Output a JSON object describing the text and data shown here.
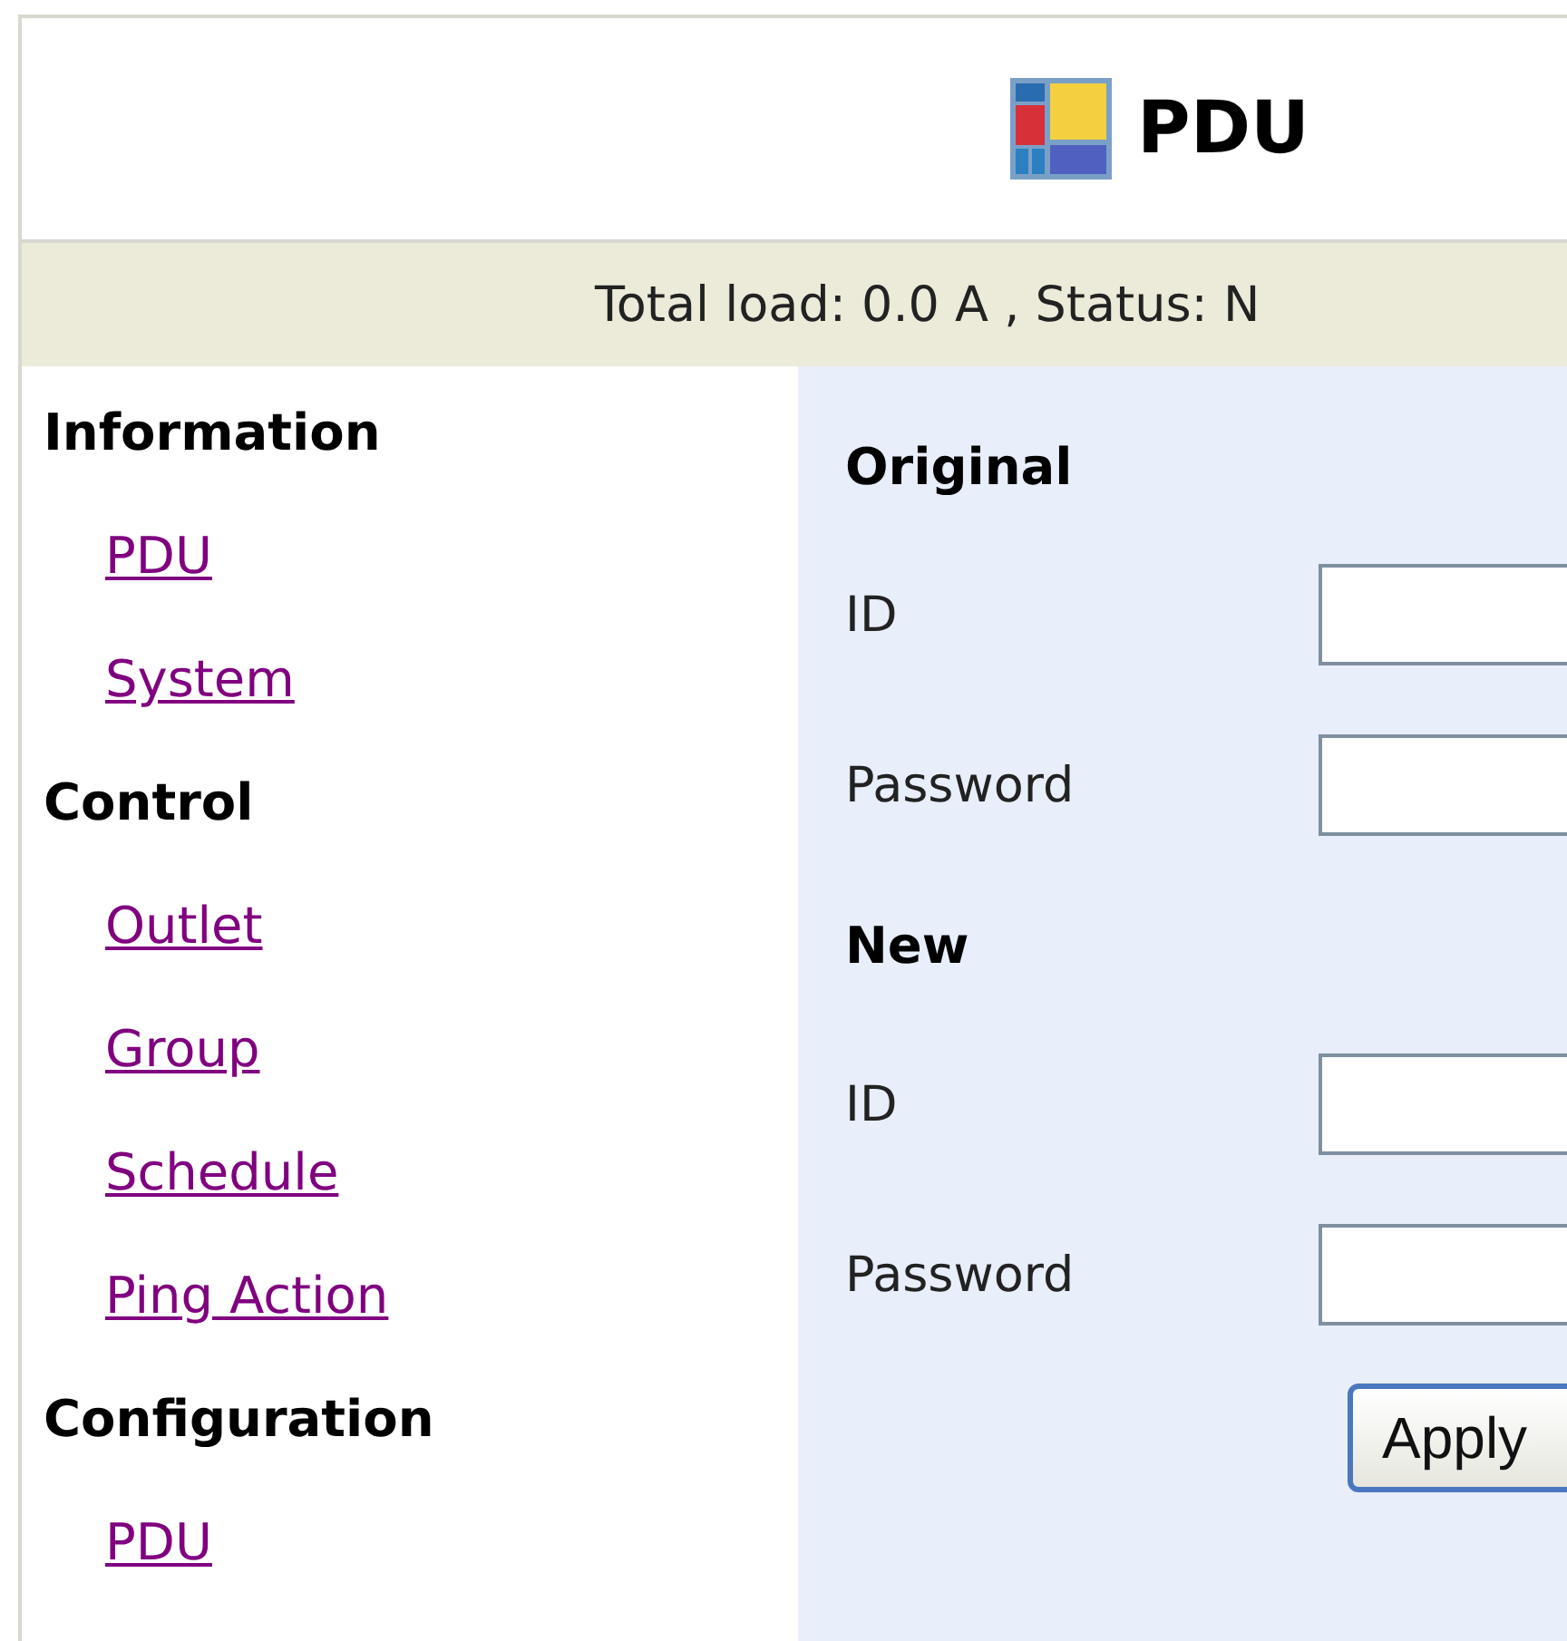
{
  "header": {
    "title": "PDU"
  },
  "status_bar": "Total load: 0.0 A , Status: N",
  "sidebar": {
    "sections": [
      {
        "heading": "Information",
        "links": [
          {
            "label": "PDU"
          },
          {
            "label": "System"
          }
        ]
      },
      {
        "heading": "Control",
        "links": [
          {
            "label": "Outlet"
          },
          {
            "label": "Group"
          },
          {
            "label": "Schedule"
          },
          {
            "label": "Ping Action"
          }
        ]
      },
      {
        "heading": "Configuration",
        "links": [
          {
            "label": "PDU"
          }
        ]
      }
    ]
  },
  "form": {
    "sections": [
      {
        "heading": "Original",
        "fields": [
          {
            "label": "ID"
          },
          {
            "label": "Password"
          }
        ]
      },
      {
        "heading": "New",
        "fields": [
          {
            "label": "ID"
          },
          {
            "label": "Password"
          }
        ]
      }
    ],
    "apply_button": "Apply"
  }
}
